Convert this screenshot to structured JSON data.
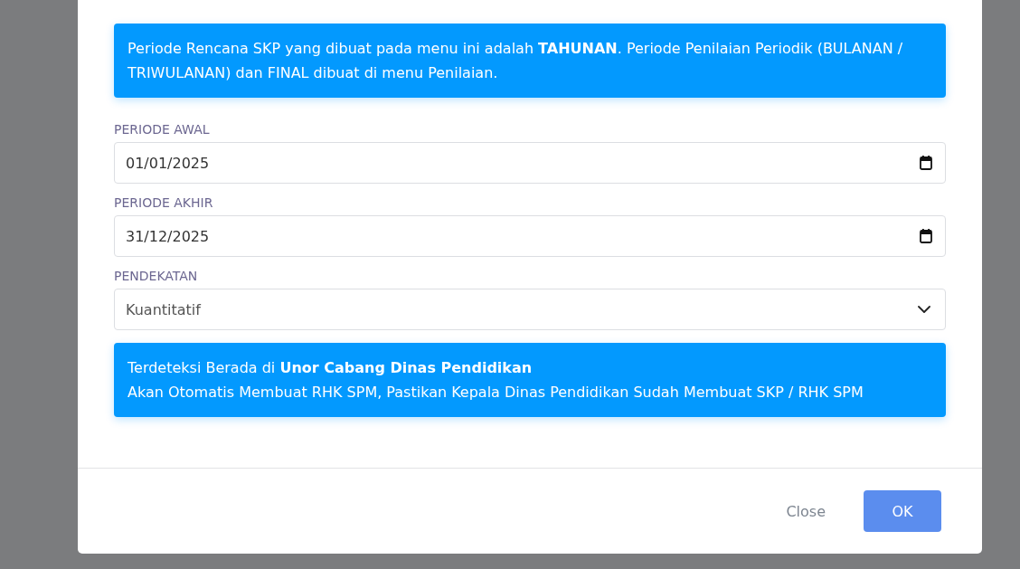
{
  "alerts": [
    {
      "text": "Periode Rencana SKP yang dibuat pada menu ini adalah **TAHUNAN**. Periode Penilaian Periodik (BULANAN / TRIWULANAN) dan FINAL dibuat di menu Penilaian."
    },
    {
      "text": "Terdeteksi Berada di **Unor Cabang Dinas Pendidikan**\nAkan Otomatis Membuat RHK SPM, Pastikan Kepala Dinas Pendidikan Sudah Membuat SKP / RHK SPM"
    }
  ],
  "fields": [
    {
      "kind": "date",
      "label": "PERIODE AWAL",
      "value": "01/01/2025"
    },
    {
      "kind": "date",
      "label": "PERIODE AKHIR",
      "value": "31/12/2025"
    },
    {
      "kind": "select",
      "label": "PENDEKATAN",
      "value": "Kuantitatif"
    }
  ],
  "buttons": [
    {
      "kind": "link",
      "label": "Close"
    },
    {
      "kind": "primary",
      "label": "OK"
    }
  ]
}
